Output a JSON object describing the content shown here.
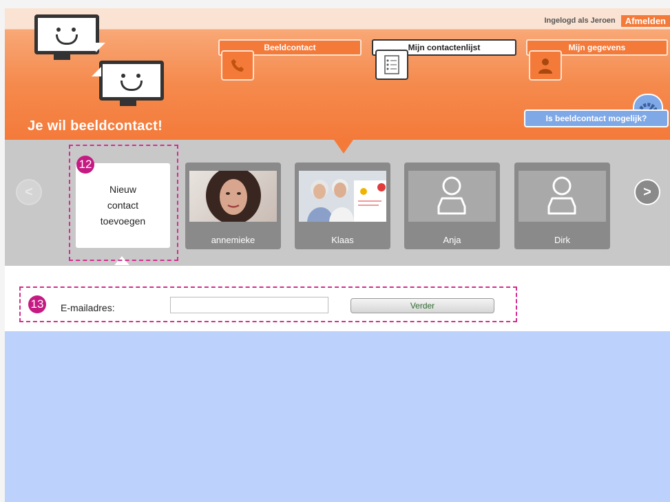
{
  "header": {
    "login_text": "Ingelogd als Jeroen",
    "logout_label": "Afmelden",
    "tagline": "Je wil beeldcontact!",
    "tabs": [
      {
        "label": "Beeldcontact",
        "icon": "phone-icon"
      },
      {
        "label": "Mijn contactenlijst",
        "icon": "contact-list-icon"
      },
      {
        "label": "Mijn gegevens",
        "icon": "person-icon"
      }
    ],
    "check_label": "Is beeldcontact mogelijk?",
    "logo_icon": "chat-monitors-icon"
  },
  "carousel": {
    "new_contact_label": "Nieuw\ncontact\ntoevoegen",
    "contacts": [
      {
        "name": "annemieke",
        "photo": "portrait-photo"
      },
      {
        "name": "Klaas",
        "photo": "couple-photo"
      },
      {
        "name": "Anja",
        "photo": "placeholder-person-icon"
      },
      {
        "name": "Dirk",
        "photo": "placeholder-person-icon"
      }
    ]
  },
  "annotations": {
    "badge_1": "12",
    "badge_2": "13"
  },
  "form": {
    "email_label": "E-mailadres:",
    "email_value": "",
    "submit_label": "Verder"
  },
  "colors": {
    "orange": "#f47a3a",
    "blue_panel": "#bcd1fb",
    "highlight": "#d42b8f"
  }
}
